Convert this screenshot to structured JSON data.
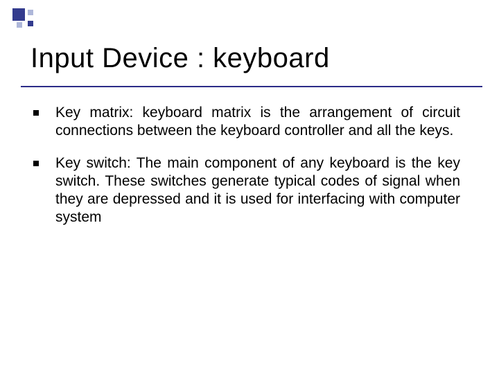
{
  "slide": {
    "title": "Input Device : keyboard",
    "bullets": [
      "Key matrix: keyboard matrix is the arrangement of circuit connections between the keyboard controller and all the keys.",
      "Key switch: The main component of any keyboard is the key switch. These switches generate typical codes of signal when they are depressed and it is used for interfacing with computer system"
    ]
  }
}
